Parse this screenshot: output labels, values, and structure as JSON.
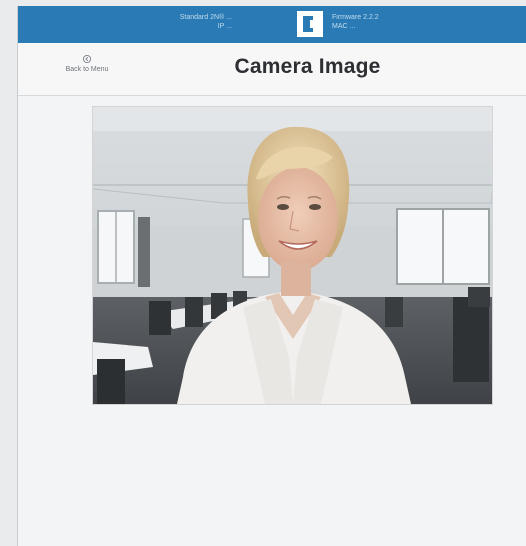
{
  "header": {
    "left_line1": "Standard 2N® ...",
    "left_line2": "IP ...",
    "right_line1": "Firmware 2.2.2",
    "right_line2": "MAC ..."
  },
  "titlebar": {
    "back_label": "Back to Menu",
    "title": "Camera Image"
  },
  "icons": {
    "logo": "brand-logo-icon",
    "back": "back-circle-icon"
  },
  "colors": {
    "header_bg": "#2a7bb5",
    "page_bg": "#f3f4f5"
  }
}
